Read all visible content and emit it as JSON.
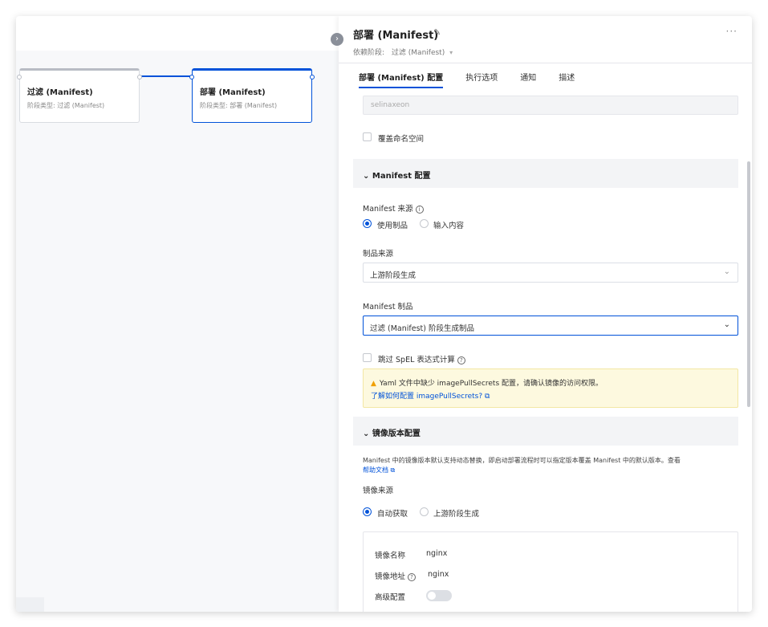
{
  "canvas": {
    "nodes": [
      {
        "title": "过滤 (Manifest)",
        "subtitle": "阶段类型: 过滤 (Manifest)"
      },
      {
        "title": "部署 (Manifest)",
        "subtitle": "阶段类型: 部署 (Manifest)"
      }
    ]
  },
  "drawer": {
    "title": "部署 (Manifest)",
    "more": "···",
    "depends_label": "依赖阶段:",
    "depends_value": "过滤 (Manifest)",
    "tabs": [
      {
        "label": "部署 (Manifest) 配置",
        "active": true
      },
      {
        "label": "执行选项",
        "active": false
      },
      {
        "label": "通知",
        "active": false
      },
      {
        "label": "描述",
        "active": false
      }
    ]
  },
  "form": {
    "namespace_value": "selinaxeon",
    "override_namespace_label": "覆盖命名空间",
    "manifest_section_title": "Manifest 配置",
    "manifest_source_label": "Manifest 来源",
    "source_options": [
      "使用制品",
      "输入内容"
    ],
    "artifact_source_label": "制品来源",
    "artifact_source_value": "上游阶段生成",
    "manifest_artifact_label": "Manifest 制品",
    "manifest_artifact_value": "过滤 (Manifest) 阶段生成制品",
    "skip_spel_label": "跳过 SpEL 表达式计算",
    "warning_text": "Yaml 文件中缺少 imagePullSecrets 配置，请确认镜像的访问权限。",
    "warning_link": "了解如何配置 imagePullSecrets?",
    "image_section_title": "镜像版本配置",
    "image_desc": "Manifest 中的镜像版本默认支持动态替换，即启动部署流程时可以指定版本覆盖 Manifest 中的默认版本。查看",
    "image_desc_link": "帮助文档",
    "image_source_label": "镜像来源",
    "image_source_options": [
      "自动获取",
      "上游阶段生成"
    ],
    "image_name_label": "镜像名称",
    "image_name_value": "nginx",
    "image_addr_label": "镜像地址",
    "image_addr_value": "nginx",
    "advanced_label": "高级配置"
  },
  "colors": {
    "accent": "#0052d9",
    "warning_bg": "#fdf9df"
  }
}
